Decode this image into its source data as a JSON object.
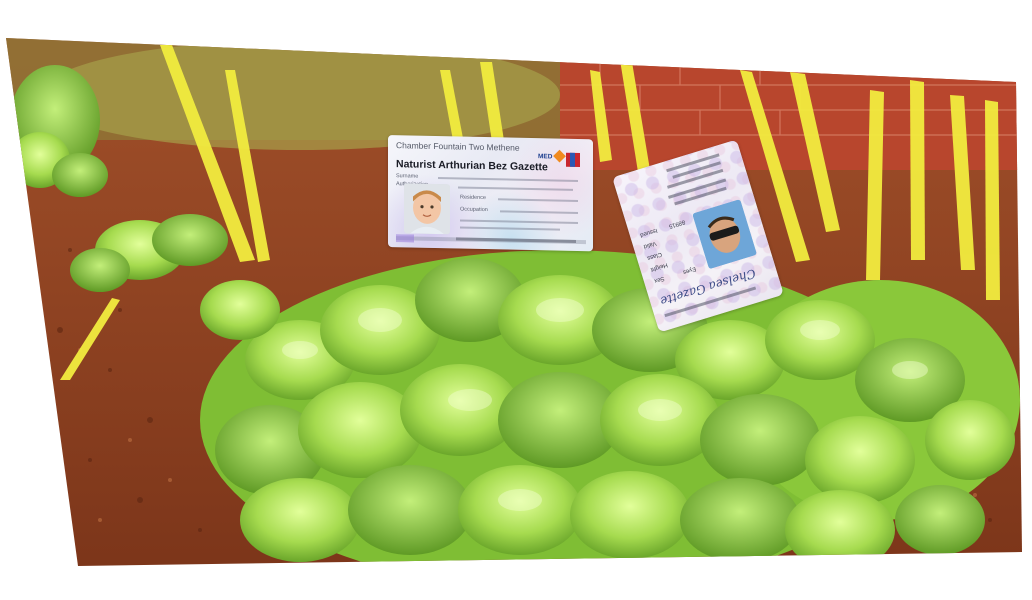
{
  "scene": {
    "description_colors": {
      "soil": "#8a3f22",
      "leaf_light": "#c8f07a",
      "leaf_mid": "#8ccb3c",
      "grass_yellow": "#f4ee4a",
      "brick": "#c5442e",
      "background": "#ffffff"
    }
  },
  "card_front": {
    "issuer": "Chamber Fountain Two Methene",
    "holder_name": "Naturist Arthurian Bez Gazette",
    "logo_text": "MED",
    "field_labels": [
      "Surname",
      "Authorization",
      "Residence",
      "Occupation"
    ],
    "colors": {
      "logo_blue": "#1d3f8f",
      "logo_orange": "#f08a1e",
      "logo_red": "#c8262e"
    }
  },
  "card_back": {
    "signature": "Chelsea Gazette",
    "field_labels": [
      "Issued",
      "Valid",
      "Class",
      "Height",
      "Sex",
      "Eyes"
    ],
    "number": "88915"
  }
}
